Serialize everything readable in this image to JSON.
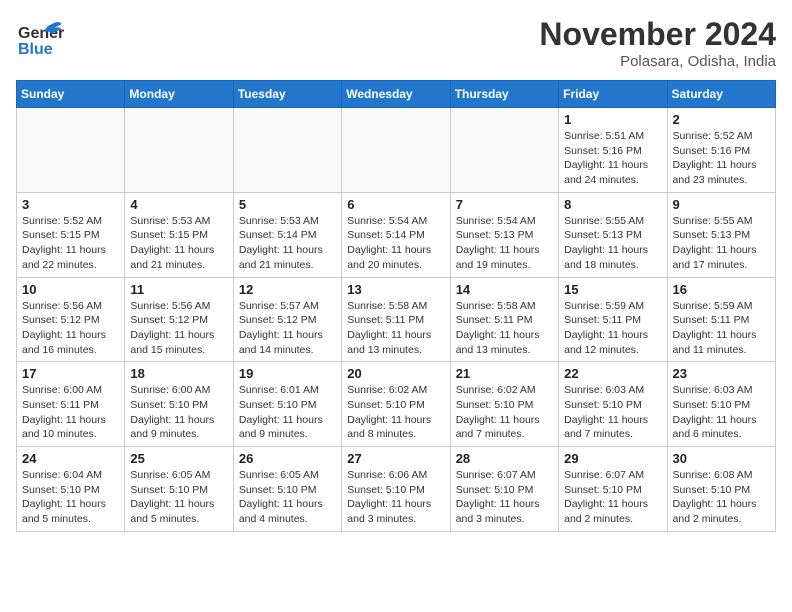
{
  "header": {
    "logo_general": "General",
    "logo_blue": "Blue",
    "title": "November 2024",
    "location": "Polasara, Odisha, India"
  },
  "days_of_week": [
    "Sunday",
    "Monday",
    "Tuesday",
    "Wednesday",
    "Thursday",
    "Friday",
    "Saturday"
  ],
  "weeks": [
    [
      {
        "day": "",
        "info": ""
      },
      {
        "day": "",
        "info": ""
      },
      {
        "day": "",
        "info": ""
      },
      {
        "day": "",
        "info": ""
      },
      {
        "day": "",
        "info": ""
      },
      {
        "day": "1",
        "info": "Sunrise: 5:51 AM\nSunset: 5:16 PM\nDaylight: 11 hours and 24 minutes."
      },
      {
        "day": "2",
        "info": "Sunrise: 5:52 AM\nSunset: 5:16 PM\nDaylight: 11 hours and 23 minutes."
      }
    ],
    [
      {
        "day": "3",
        "info": "Sunrise: 5:52 AM\nSunset: 5:15 PM\nDaylight: 11 hours and 22 minutes."
      },
      {
        "day": "4",
        "info": "Sunrise: 5:53 AM\nSunset: 5:15 PM\nDaylight: 11 hours and 21 minutes."
      },
      {
        "day": "5",
        "info": "Sunrise: 5:53 AM\nSunset: 5:14 PM\nDaylight: 11 hours and 21 minutes."
      },
      {
        "day": "6",
        "info": "Sunrise: 5:54 AM\nSunset: 5:14 PM\nDaylight: 11 hours and 20 minutes."
      },
      {
        "day": "7",
        "info": "Sunrise: 5:54 AM\nSunset: 5:13 PM\nDaylight: 11 hours and 19 minutes."
      },
      {
        "day": "8",
        "info": "Sunrise: 5:55 AM\nSunset: 5:13 PM\nDaylight: 11 hours and 18 minutes."
      },
      {
        "day": "9",
        "info": "Sunrise: 5:55 AM\nSunset: 5:13 PM\nDaylight: 11 hours and 17 minutes."
      }
    ],
    [
      {
        "day": "10",
        "info": "Sunrise: 5:56 AM\nSunset: 5:12 PM\nDaylight: 11 hours and 16 minutes."
      },
      {
        "day": "11",
        "info": "Sunrise: 5:56 AM\nSunset: 5:12 PM\nDaylight: 11 hours and 15 minutes."
      },
      {
        "day": "12",
        "info": "Sunrise: 5:57 AM\nSunset: 5:12 PM\nDaylight: 11 hours and 14 minutes."
      },
      {
        "day": "13",
        "info": "Sunrise: 5:58 AM\nSunset: 5:11 PM\nDaylight: 11 hours and 13 minutes."
      },
      {
        "day": "14",
        "info": "Sunrise: 5:58 AM\nSunset: 5:11 PM\nDaylight: 11 hours and 13 minutes."
      },
      {
        "day": "15",
        "info": "Sunrise: 5:59 AM\nSunset: 5:11 PM\nDaylight: 11 hours and 12 minutes."
      },
      {
        "day": "16",
        "info": "Sunrise: 5:59 AM\nSunset: 5:11 PM\nDaylight: 11 hours and 11 minutes."
      }
    ],
    [
      {
        "day": "17",
        "info": "Sunrise: 6:00 AM\nSunset: 5:11 PM\nDaylight: 11 hours and 10 minutes."
      },
      {
        "day": "18",
        "info": "Sunrise: 6:00 AM\nSunset: 5:10 PM\nDaylight: 11 hours and 9 minutes."
      },
      {
        "day": "19",
        "info": "Sunrise: 6:01 AM\nSunset: 5:10 PM\nDaylight: 11 hours and 9 minutes."
      },
      {
        "day": "20",
        "info": "Sunrise: 6:02 AM\nSunset: 5:10 PM\nDaylight: 11 hours and 8 minutes."
      },
      {
        "day": "21",
        "info": "Sunrise: 6:02 AM\nSunset: 5:10 PM\nDaylight: 11 hours and 7 minutes."
      },
      {
        "day": "22",
        "info": "Sunrise: 6:03 AM\nSunset: 5:10 PM\nDaylight: 11 hours and 7 minutes."
      },
      {
        "day": "23",
        "info": "Sunrise: 6:03 AM\nSunset: 5:10 PM\nDaylight: 11 hours and 6 minutes."
      }
    ],
    [
      {
        "day": "24",
        "info": "Sunrise: 6:04 AM\nSunset: 5:10 PM\nDaylight: 11 hours and 5 minutes."
      },
      {
        "day": "25",
        "info": "Sunrise: 6:05 AM\nSunset: 5:10 PM\nDaylight: 11 hours and 5 minutes."
      },
      {
        "day": "26",
        "info": "Sunrise: 6:05 AM\nSunset: 5:10 PM\nDaylight: 11 hours and 4 minutes."
      },
      {
        "day": "27",
        "info": "Sunrise: 6:06 AM\nSunset: 5:10 PM\nDaylight: 11 hours and 3 minutes."
      },
      {
        "day": "28",
        "info": "Sunrise: 6:07 AM\nSunset: 5:10 PM\nDaylight: 11 hours and 3 minutes."
      },
      {
        "day": "29",
        "info": "Sunrise: 6:07 AM\nSunset: 5:10 PM\nDaylight: 11 hours and 2 minutes."
      },
      {
        "day": "30",
        "info": "Sunrise: 6:08 AM\nSunset: 5:10 PM\nDaylight: 11 hours and 2 minutes."
      }
    ]
  ]
}
